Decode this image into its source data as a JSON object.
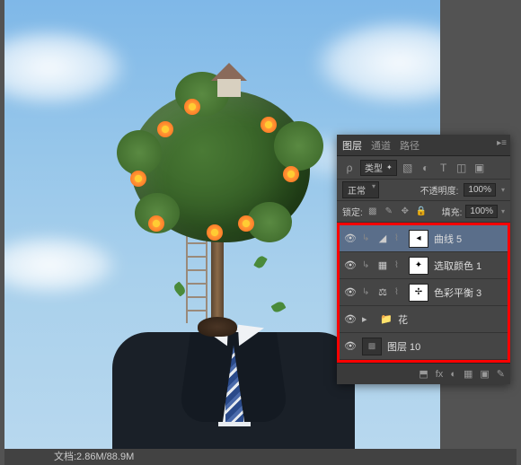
{
  "statusbar": {
    "doc_info": "文档:2.86M/88.9M"
  },
  "panel": {
    "tabs": {
      "layers": "图层",
      "channels": "通道",
      "paths": "路径"
    },
    "filter": {
      "label": "类型"
    },
    "blend": {
      "mode": "正常",
      "opacity_label": "不透明度:",
      "opacity_value": "100%"
    },
    "lock": {
      "label": "锁定:",
      "fill_label": "填充:",
      "fill_value": "100%"
    }
  },
  "layers": [
    {
      "name": "曲线 5",
      "kind": "adj",
      "icon": "◢",
      "mask": "◂",
      "selected": true
    },
    {
      "name": "选取颜色 1",
      "kind": "adj",
      "icon": "▦",
      "mask": "✦",
      "selected": false
    },
    {
      "name": "色彩平衡 3",
      "kind": "adj",
      "icon": "⚖",
      "mask": "✢",
      "selected": false
    },
    {
      "name": "花",
      "kind": "group",
      "selected": false
    },
    {
      "name": "图层 10",
      "kind": "raster",
      "selected": false
    }
  ],
  "footer_icons": [
    "⬒",
    "fx",
    "◐",
    "▦",
    "▣",
    "✎"
  ]
}
